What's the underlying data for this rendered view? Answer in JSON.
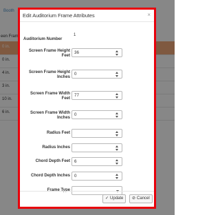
{
  "background": {
    "link_text": "Booth",
    "column_header": "een Fram",
    "rows": [
      "0 in.",
      "0 in.",
      "4 in.",
      "3 in.",
      "10 in.",
      "6 in."
    ],
    "highlight_color": "#f0a87a"
  },
  "modal": {
    "title": "Edit Auditorium Frame Attributes",
    "close_glyph": "×",
    "fields": {
      "auditorium_number": {
        "label": "Auditorium Number",
        "value": "1"
      },
      "screen_height_feet": {
        "label": "Screen Frame Height Feet",
        "value": "36"
      },
      "screen_height_inches": {
        "label": "Screen Frame Height Inches",
        "value": "0"
      },
      "screen_width_feet": {
        "label": "Screen Frame Width Feet",
        "value": "77"
      },
      "screen_width_inches": {
        "label": "Screen Frame Width Inches",
        "value": "0"
      },
      "radius_feet": {
        "label": "Radius Feet",
        "value": ""
      },
      "radius_inches": {
        "label": "Radius Inches",
        "value": ""
      },
      "chord_depth_feet": {
        "label": "Chord Depth Feet",
        "value": "6"
      },
      "chord_depth_inches": {
        "label": "Chord Depth Inches",
        "value": "0"
      },
      "frame_type": {
        "label": "Frame Type",
        "value": ""
      }
    },
    "buttons": {
      "update": "Update",
      "cancel": "Cancel"
    },
    "border_color": "#e8000b"
  }
}
